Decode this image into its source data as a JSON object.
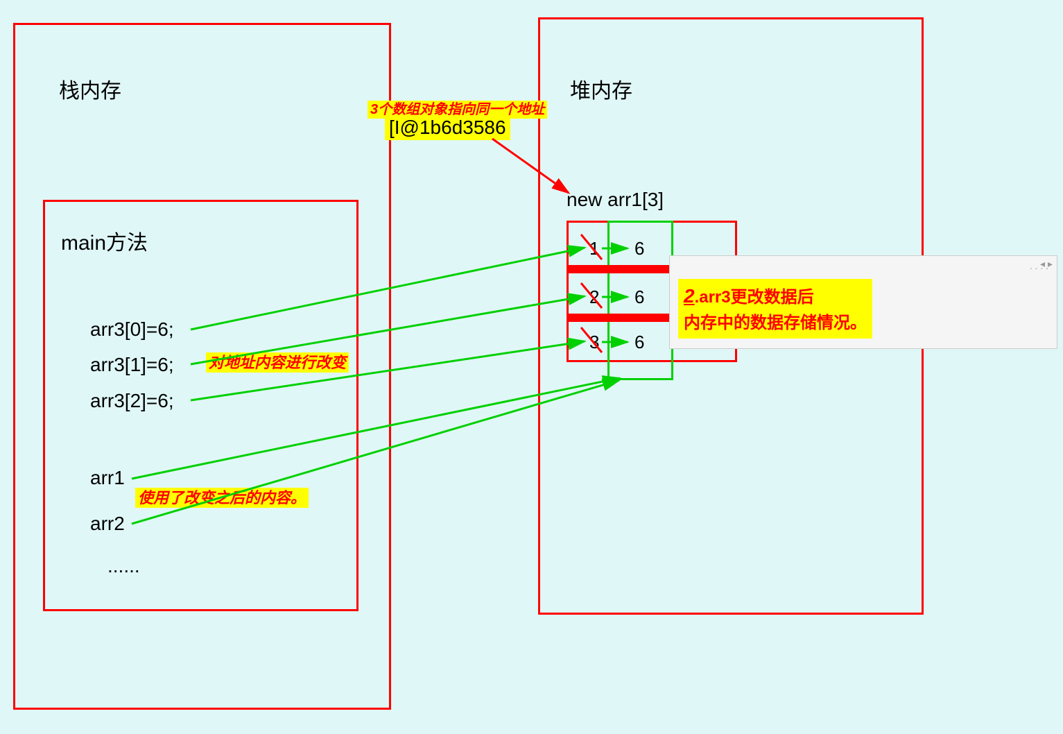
{
  "stack": {
    "title": "栈内存",
    "main_method": {
      "title": "main方法",
      "lines": [
        "arr3[0]=6;",
        "arr3[1]=6;",
        "arr3[2]=6;",
        "arr1",
        "arr2",
        "......"
      ]
    }
  },
  "heap": {
    "title": "堆内存",
    "array_decl": "new arr1[3]",
    "cells": [
      {
        "old": "1",
        "new": "6"
      },
      {
        "old": "2",
        "new": "6"
      },
      {
        "old": "3",
        "new": "6"
      }
    ]
  },
  "address": {
    "annotation": "3个数组对象指向同一个地址",
    "value": "[I@1b6d3586"
  },
  "annotations": {
    "change_content": "对地址内容进行改变",
    "use_changed": "使用了改变之后的内容。",
    "tooltip_num": "2",
    "tooltip_line1": ".arr3更改数据后",
    "tooltip_line2": "内存中的数据存储情况。"
  }
}
